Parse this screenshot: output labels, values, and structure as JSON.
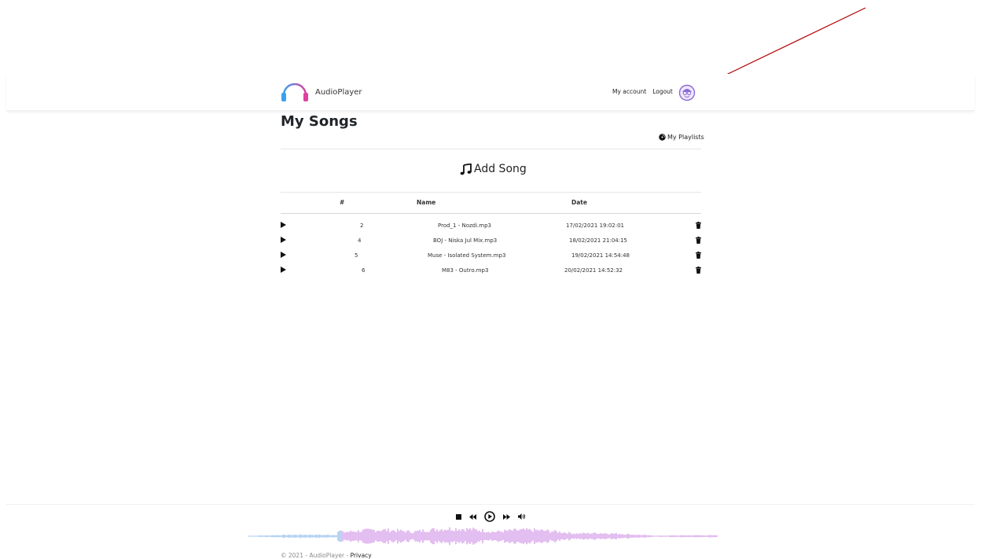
{
  "brand": {
    "name": "AudioPlayer"
  },
  "nav": {
    "my_account": "My account",
    "logout": "Logout"
  },
  "page": {
    "title": "My Songs",
    "playlists_link": "My Playlists",
    "add_song": "Add Song"
  },
  "table": {
    "headers": {
      "number": "#",
      "name": "Name",
      "date": "Date"
    },
    "rows": [
      {
        "number": "2",
        "name": "Prod_1 - Nozdi.mp3",
        "date": "17/02/2021 19:02:01"
      },
      {
        "number": "4",
        "name": "BOJ - Niska Jul Mix.mp3",
        "date": "18/02/2021 21:04:15"
      },
      {
        "number": "5",
        "name": "Muse - Isolated System.mp3",
        "date": "19/02/2021 14:54:48"
      },
      {
        "number": "6",
        "name": "M83 - Outro.mp3",
        "date": "20/02/2021 14:52:32"
      }
    ]
  },
  "footer": {
    "copyright": "© 2021 - AudioPlayer - ",
    "privacy": "Privacy"
  },
  "colors": {
    "annotation_arrow": "#b30000",
    "waveform_played": "#6fa8e8",
    "waveform_unplayed": "#c77ee0",
    "avatar": "#8a6bd6"
  },
  "player": {
    "progress": 0.2
  }
}
